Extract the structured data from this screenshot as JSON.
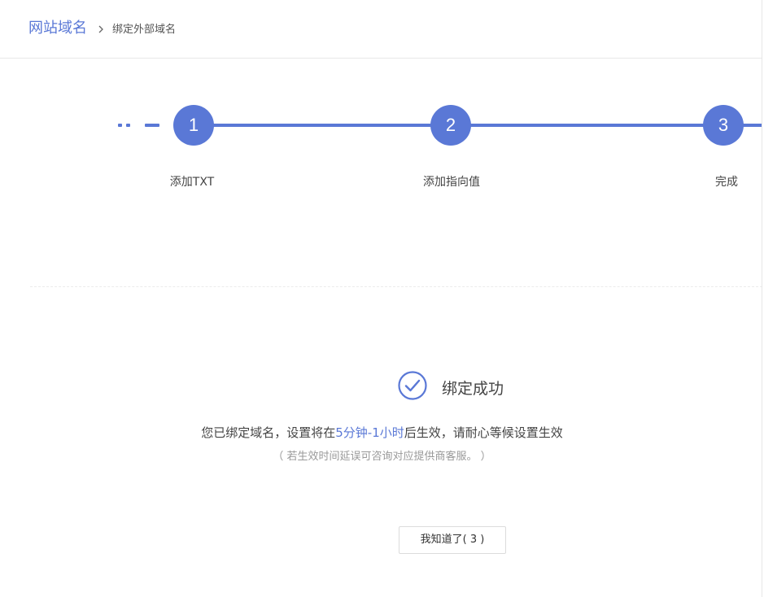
{
  "breadcrumb": {
    "root": "网站域名",
    "separator_icon": "chevron-right-icon",
    "current": "绑定外部域名"
  },
  "steps": [
    {
      "number": "1",
      "label": "添加TXT"
    },
    {
      "number": "2",
      "label": "添加指向值"
    },
    {
      "number": "3",
      "label": "完成"
    }
  ],
  "result": {
    "icon": "check-circle-icon",
    "title": "绑定成功",
    "message_before": "您已绑定域名，设置将在",
    "message_highlight": "5分钟-1小时",
    "message_after": "后生效，请耐心等候设置生效",
    "note": "（ 若生效时间延误可咨询对应提供商客服。 ）"
  },
  "button": {
    "label": "我知道了( 3 )"
  },
  "colors": {
    "accent": "#5a78d6",
    "text": "#444444",
    "muted": "#999999",
    "border": "#dcdcdc"
  }
}
